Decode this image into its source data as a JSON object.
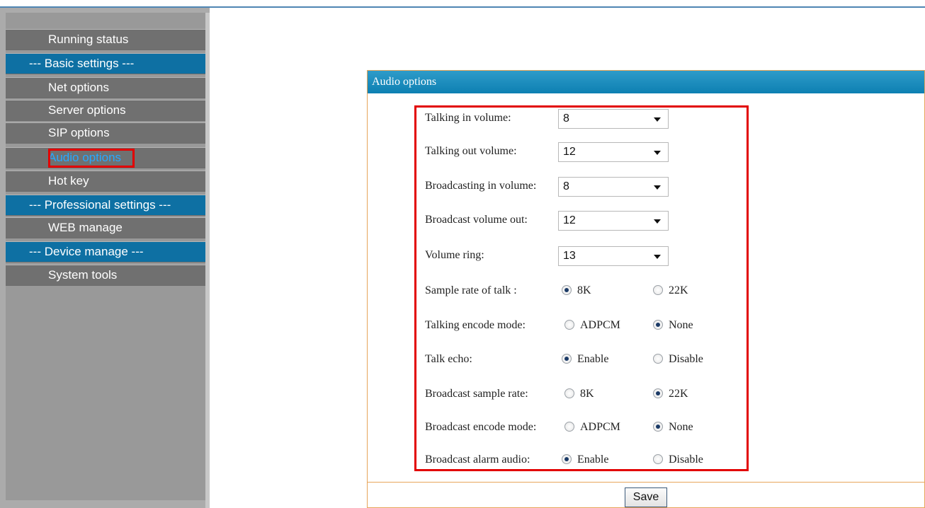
{
  "sidebar": {
    "items": [
      {
        "label": "Running status"
      },
      {
        "label": "--- Basic settings ---"
      },
      {
        "label": "Net options"
      },
      {
        "label": "Server options"
      },
      {
        "label": "SIP options"
      },
      {
        "label": "Audio options"
      },
      {
        "label": "Hot key"
      },
      {
        "label": "--- Professional settings ---"
      },
      {
        "label": "WEB manage"
      },
      {
        "label": "--- Device manage ---"
      },
      {
        "label": "System tools"
      }
    ]
  },
  "panel": {
    "title": "Audio options",
    "selects": [
      {
        "label": "Talking in volume:",
        "value": "8"
      },
      {
        "label": "Talking out volume:",
        "value": "12"
      },
      {
        "label": "Broadcasting in volume:",
        "value": "8"
      },
      {
        "label": "Broadcast volume out:",
        "value": "12"
      },
      {
        "label": "Volume ring:",
        "value": "13"
      }
    ],
    "radios": [
      {
        "label": "Sample rate of talk :",
        "opt1": "8K",
        "opt2": "22K",
        "selected": 1
      },
      {
        "label": "Talking encode mode:",
        "opt1": "ADPCM",
        "opt2": "None",
        "selected": 2
      },
      {
        "label": "Talk echo:",
        "opt1": "Enable",
        "opt2": "Disable",
        "selected": 1
      },
      {
        "label": "Broadcast sample rate:",
        "opt1": "8K",
        "opt2": "22K",
        "selected": 2
      },
      {
        "label": "Broadcast encode mode:",
        "opt1": "ADPCM",
        "opt2": "None",
        "selected": 2
      },
      {
        "label": "Broadcast alarm audio:",
        "opt1": "Enable",
        "opt2": "Disable",
        "selected": 1
      }
    ],
    "save_label": "Save"
  },
  "colors": {
    "menu_gray": "#707070",
    "menu_blue": "#0e70a3",
    "highlight_red": "#e20000",
    "panel_header": "#0d80b2",
    "active_link": "#27a8ff"
  }
}
